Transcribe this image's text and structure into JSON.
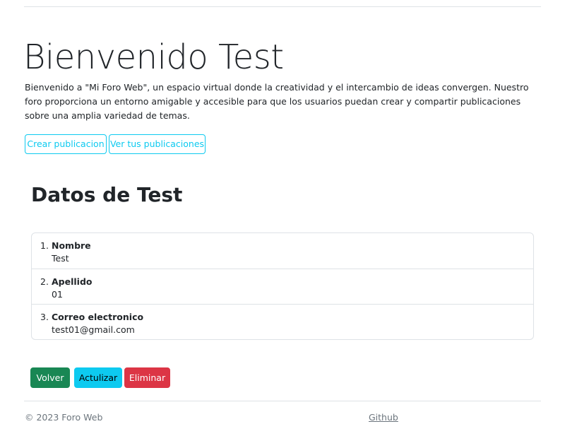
{
  "header": {
    "title": "Bienvenido Test",
    "intro": "Bienvenido a \"Mi Foro Web\", un espacio virtual donde la creatividad y el intercambio de ideas convergen. Nuestro foro proporciona un entorno amigable y accesible para que los usuarios puedan crear y compartir publicaciones sobre una amplia variedad de temas."
  },
  "actions": {
    "create_label": "Crear publicacion",
    "view_label": "Ver tus publicaciones"
  },
  "user_data": {
    "heading": "Datos de Test",
    "items": [
      {
        "index": "1.",
        "label": "Nombre",
        "value": "Test"
      },
      {
        "index": "2.",
        "label": "Apellido",
        "value": "01"
      },
      {
        "index": "3.",
        "label": "Correo electronico",
        "value": "test01@gmail.com"
      }
    ]
  },
  "buttons": {
    "back_label": "Volver",
    "update_label": "Actulizar",
    "delete_label": "Eliminar"
  },
  "footer": {
    "copyright": "© 2023 Foro Web",
    "github_link": "Github"
  },
  "colors": {
    "info": "#0dcaf0",
    "success": "#198754",
    "danger": "#dc3545",
    "border": "#dee2e6",
    "muted": "#6c757d"
  }
}
